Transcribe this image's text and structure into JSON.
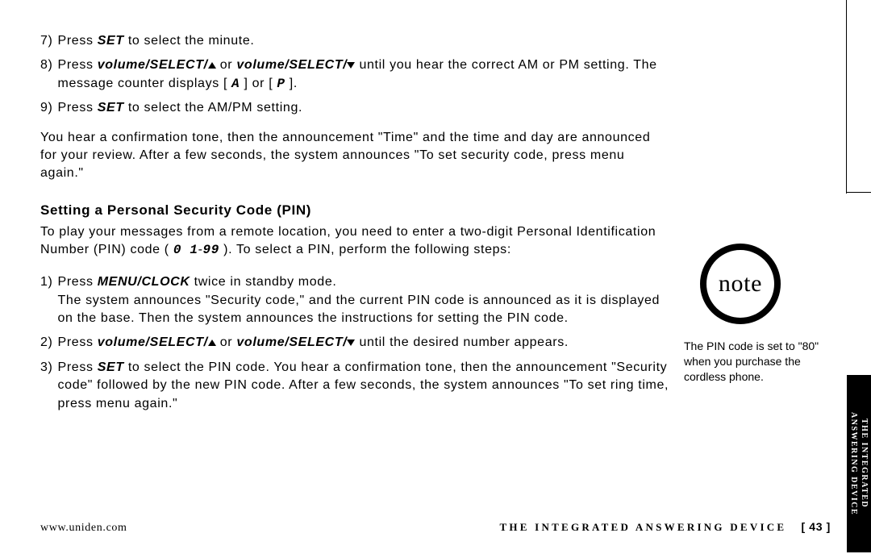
{
  "steps_top": [
    {
      "num": "7)",
      "parts": [
        {
          "t": "Press "
        },
        {
          "t": "SET",
          "cls": "bold"
        },
        {
          "t": " to select the minute."
        }
      ]
    },
    {
      "num": "8)",
      "parts": [
        {
          "t": "Press "
        },
        {
          "t": "volume/SELECT/",
          "cls": "bold"
        },
        {
          "caret": "up"
        },
        {
          "t": " or "
        },
        {
          "t": "volume/SELECT/",
          "cls": "bold"
        },
        {
          "caret": "down"
        },
        {
          "t": " until you hear the correct AM or PM setting. The message counter displays [ "
        },
        {
          "t": "A",
          "cls": "seg"
        },
        {
          "t": " ] or [ "
        },
        {
          "t": "P",
          "cls": "seg"
        },
        {
          "t": " ]."
        }
      ]
    },
    {
      "num": "9)",
      "parts": [
        {
          "t": "Press "
        },
        {
          "t": "SET",
          "cls": "bold"
        },
        {
          "t": " to select the AM/PM setting."
        }
      ]
    }
  ],
  "para_confirm": "You hear a confirmation tone, then the announcement \"Time\" and the time and day are announced for your review. After a few seconds, the system announces \"To set security code, press menu again.\"",
  "heading": "Setting a Personal Security Code (PIN)",
  "para_intro_parts": [
    {
      "t": "To play your messages from a remote location, you need to enter a two-digit Personal Identification Number (PIN) code ( "
    },
    {
      "t": "0 1",
      "cls": "seg"
    },
    {
      "t": "-"
    },
    {
      "t": "99",
      "cls": "seg"
    },
    {
      "t": " ). To select a PIN, perform the following steps:"
    }
  ],
  "steps_pin": [
    {
      "num": "1)",
      "parts": [
        {
          "t": "Press "
        },
        {
          "t": "MENU/CLOCK",
          "cls": "bold"
        },
        {
          "t": " twice in standby mode."
        },
        {
          "br": true
        },
        {
          "t": "The system announces \"Security code,\" and the current PIN code is announced as it is displayed on the base. Then the system announces the instructions for setting the PIN code."
        }
      ]
    },
    {
      "num": "2)",
      "parts": [
        {
          "t": "Press "
        },
        {
          "t": "volume/SELECT/",
          "cls": "bold"
        },
        {
          "caret": "up"
        },
        {
          "t": " or "
        },
        {
          "t": "volume/SELECT/",
          "cls": "bold"
        },
        {
          "caret": "down"
        },
        {
          "t": " until the desired number appears."
        }
      ]
    },
    {
      "num": "3)",
      "parts": [
        {
          "t": "Press "
        },
        {
          "t": "SET",
          "cls": "bold"
        },
        {
          "t": " to select the PIN code. You hear a confirmation tone, then the announcement \"Security code\" followed by the new PIN code. After a few seconds, the system announces \"To set ring time, press menu again.\""
        }
      ]
    }
  ],
  "note": {
    "label": "note",
    "text": "The PIN code is set to \"80\" when you purchase the cordless phone."
  },
  "side_tab": "THE INTEGRATED\nANSWERING DEVICE",
  "footer": {
    "url": "www.uniden.com",
    "section": "THE INTEGRATED ANSWERING DEVICE",
    "page": "[ 43 ]"
  }
}
